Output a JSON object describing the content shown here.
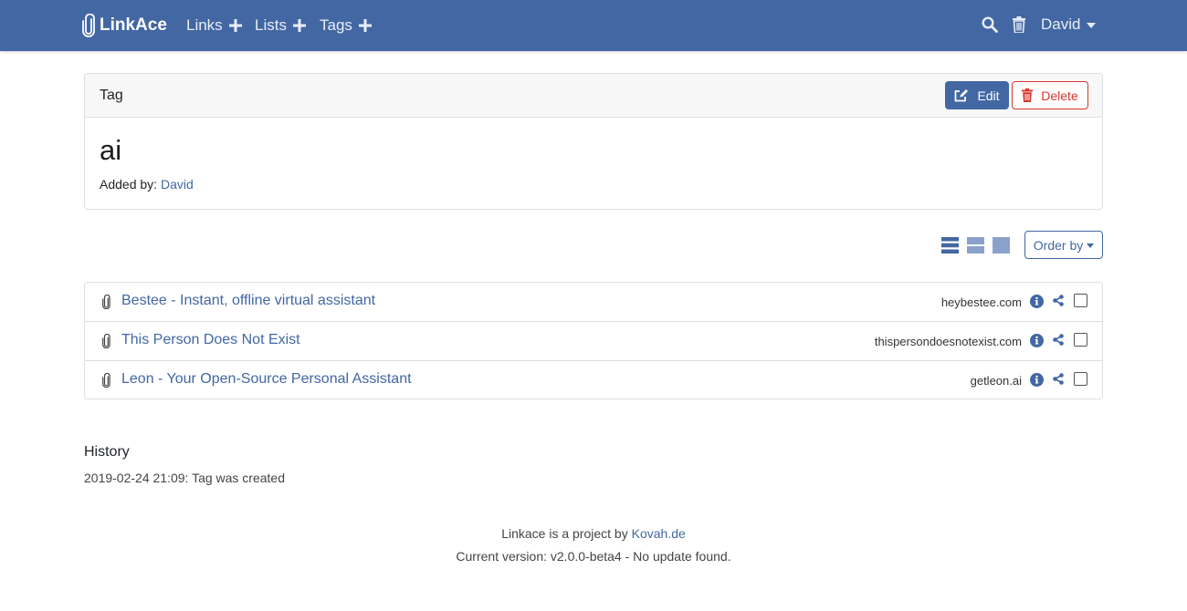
{
  "colors": {
    "primary": "#4267a3",
    "danger": "#d9362b"
  },
  "navbar": {
    "brand": "LinkAce",
    "items": [
      {
        "label": "Links",
        "icon": "plus-icon"
      },
      {
        "label": "Lists",
        "icon": "plus-icon"
      },
      {
        "label": "Tags",
        "icon": "plus-icon"
      }
    ],
    "search_icon": "search-icon",
    "trash_icon": "trash-icon",
    "user": "David"
  },
  "tag_card": {
    "header": "Tag",
    "edit_label": "Edit",
    "delete_label": "Delete",
    "name": "ai",
    "added_by_label": "Added by:",
    "added_by_user": "David"
  },
  "view_controls": {
    "modes": [
      "list-view-icon",
      "cards-detailed-view-icon",
      "cards-view-icon"
    ],
    "order_label": "Order by"
  },
  "links": [
    {
      "title": "Bestee - Instant, offline virtual assistant",
      "domain": "heybestee.com"
    },
    {
      "title": "This Person Does Not Exist",
      "domain": "thispersondoesnotexist.com"
    },
    {
      "title": "Leon - Your Open-Source Personal Assistant",
      "domain": "getleon.ai"
    }
  ],
  "history": {
    "title": "History",
    "entries": [
      "2019-02-24 21:09: Tag was created"
    ]
  },
  "footer": {
    "project_text": "Linkace is a project by",
    "project_link": "Kovah.de",
    "version_text": "Current version: v2.0.0-beta4 - No update found."
  }
}
